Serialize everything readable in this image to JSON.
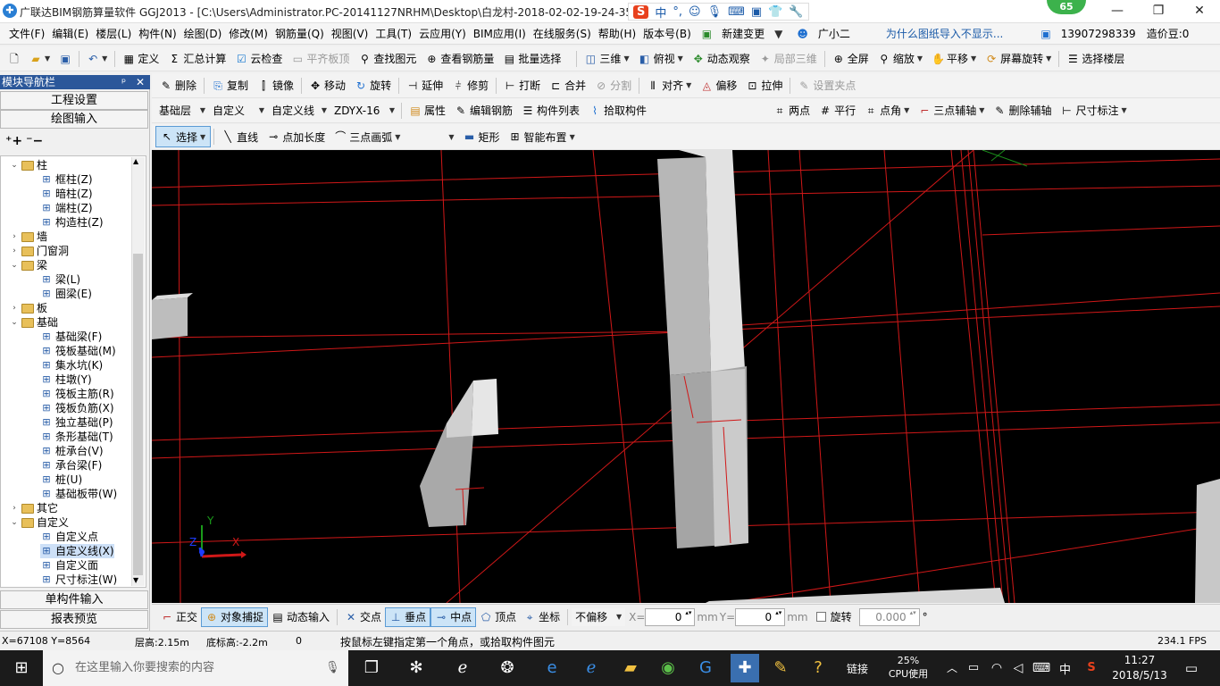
{
  "titlebar": {
    "title": "广联达BIM钢筋算量软件 GGJ2013 - [C:\\Users\\Administrator.PC-20141127NRHM\\Desktop\\白龙村-2018-02-02-19-24-35",
    "ime_label": "中",
    "badge": "65",
    "minimize": "—",
    "maximize": "❐",
    "close": "✕"
  },
  "menubar": {
    "items": [
      "文件(F)",
      "编辑(E)",
      "楼层(L)",
      "构件(N)",
      "绘图(D)",
      "修改(M)",
      "钢筋量(Q)",
      "视图(V)",
      "工具(T)",
      "云应用(Y)",
      "BIM应用(I)",
      "在线服务(S)",
      "帮助(H)",
      "版本号(B)"
    ],
    "new_change": "新建变更",
    "guang": "广小二",
    "question_link": "为什么图纸导入不显示...",
    "phone": "13907298339",
    "zaojia": "造价豆:0"
  },
  "toolbar1": {
    "items": [
      "定义",
      "汇总计算",
      "云检查",
      "平齐板顶",
      "查找图元",
      "查看钢筋量",
      "批量选择",
      "三维",
      "俯视",
      "动态观察",
      "局部三维",
      "全屏",
      "缩放",
      "平移",
      "屏幕旋转",
      "选择楼层"
    ]
  },
  "toolbar2": {
    "items": [
      "删除",
      "复制",
      "镜像",
      "移动",
      "旋转",
      "延伸",
      "修剪",
      "打断",
      "合并",
      "分割",
      "对齐",
      "偏移",
      "拉伸",
      "设置夹点"
    ]
  },
  "toolbar3": {
    "floor": "基础层",
    "type": "自定义",
    "subtype": "自定义线",
    "component": "ZDYX-16",
    "items": [
      "属性",
      "编辑钢筋",
      "构件列表",
      "拾取构件"
    ],
    "axis_items": [
      "两点",
      "平行",
      "点角",
      "三点辅轴",
      "删除辅轴",
      "尺寸标注"
    ]
  },
  "toolbar4": {
    "select": "选择",
    "items": [
      "直线",
      "点加长度",
      "三点画弧",
      "矩形",
      "智能布置"
    ]
  },
  "panel": {
    "header": "模块导航栏",
    "pin": "ᵖ",
    "close": "✕",
    "btn_project": "工程设置",
    "btn_draw": "绘图输入",
    "btn_single": "单构件输入",
    "btn_report": "报表预览",
    "tree": [
      {
        "label": "柱",
        "kind": "folder",
        "exp": "⌄",
        "level": 0
      },
      {
        "label": "框柱(Z)",
        "kind": "leaf",
        "level": 1
      },
      {
        "label": "暗柱(Z)",
        "kind": "leaf",
        "level": 1
      },
      {
        "label": "端柱(Z)",
        "kind": "leaf",
        "level": 1
      },
      {
        "label": "构造柱(Z)",
        "kind": "leaf",
        "level": 1
      },
      {
        "label": "墙",
        "kind": "folder",
        "exp": "›",
        "level": 0
      },
      {
        "label": "门窗洞",
        "kind": "folder",
        "exp": "›",
        "level": 0
      },
      {
        "label": "梁",
        "kind": "folder",
        "exp": "⌄",
        "level": 0
      },
      {
        "label": "梁(L)",
        "kind": "leaf",
        "level": 1
      },
      {
        "label": "圈梁(E)",
        "kind": "leaf",
        "level": 1
      },
      {
        "label": "板",
        "kind": "folder",
        "exp": "›",
        "level": 0
      },
      {
        "label": "基础",
        "kind": "folder",
        "exp": "⌄",
        "level": 0
      },
      {
        "label": "基础梁(F)",
        "kind": "leaf",
        "level": 1
      },
      {
        "label": "筏板基础(M)",
        "kind": "leaf",
        "level": 1
      },
      {
        "label": "集水坑(K)",
        "kind": "leaf",
        "level": 1
      },
      {
        "label": "柱墩(Y)",
        "kind": "leaf",
        "level": 1
      },
      {
        "label": "筏板主筋(R)",
        "kind": "leaf",
        "level": 1
      },
      {
        "label": "筏板负筋(X)",
        "kind": "leaf",
        "level": 1
      },
      {
        "label": "独立基础(P)",
        "kind": "leaf",
        "level": 1
      },
      {
        "label": "条形基础(T)",
        "kind": "leaf",
        "level": 1
      },
      {
        "label": "桩承台(V)",
        "kind": "leaf",
        "level": 1
      },
      {
        "label": "承台梁(F)",
        "kind": "leaf",
        "level": 1
      },
      {
        "label": "桩(U)",
        "kind": "leaf",
        "level": 1
      },
      {
        "label": "基础板带(W)",
        "kind": "leaf",
        "level": 1
      },
      {
        "label": "其它",
        "kind": "folder",
        "exp": "›",
        "level": 0
      },
      {
        "label": "自定义",
        "kind": "folder",
        "exp": "⌄",
        "level": 0
      },
      {
        "label": "自定义点",
        "kind": "leaf",
        "level": 1
      },
      {
        "label": "自定义线(X)",
        "kind": "leaf",
        "level": 1,
        "selected": true
      },
      {
        "label": "自定义面",
        "kind": "leaf",
        "level": 1
      },
      {
        "label": "尺寸标注(W)",
        "kind": "leaf",
        "level": 1
      }
    ]
  },
  "snapbar": {
    "items": [
      "正交",
      "对象捕捉",
      "动态输入",
      "交点",
      "垂点",
      "中点",
      "顶点",
      "坐标"
    ],
    "offset": "不偏移",
    "x_label": "X=",
    "x_value": "0",
    "y_label": "Y=",
    "y_value": "0",
    "unit": "mm",
    "rotate_label": "旋转",
    "rotate_value": "0.000",
    "degree": "°"
  },
  "statusbar": {
    "coords": "X=67108 Y=8564",
    "floor_height": "层高:2.15m",
    "bottom_height": "底标高:-2.2m",
    "zero": "0",
    "hint": "按鼠标左键指定第一个角点，或拾取构件图元",
    "fps": "234.1 FPS"
  },
  "canvas": {
    "axis_x": "X",
    "axis_y": "Y",
    "axis_z": "Z"
  },
  "taskbar": {
    "search_placeholder": "在这里输入你要搜索的内容",
    "link": "链接",
    "cpu_percent": "25%",
    "cpu_label": "CPU使用",
    "lang": "中",
    "time": "11:27",
    "date": "2018/5/13"
  }
}
